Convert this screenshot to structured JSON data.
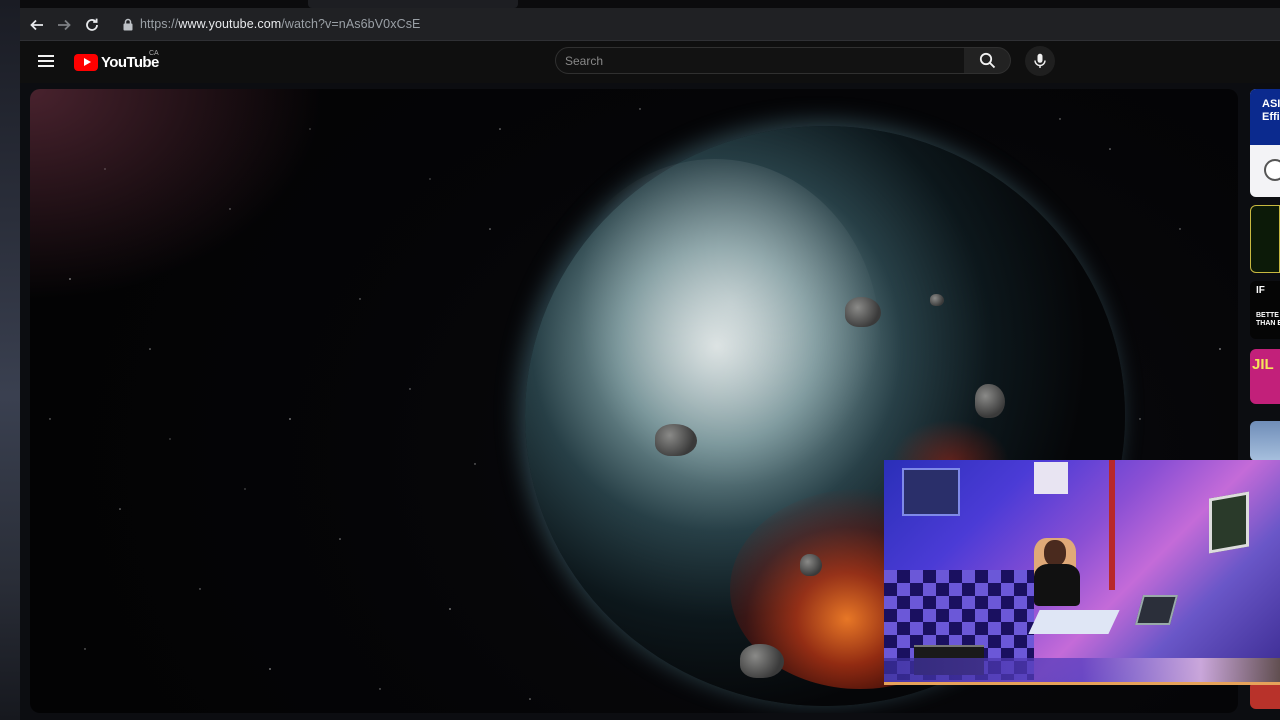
{
  "browser": {
    "url_prefix": "https://",
    "url_host": "www.youtube.com",
    "url_path": "/watch?v=nAs6bV0xCsE"
  },
  "youtube": {
    "logo_text": "YouTube",
    "region": "CA",
    "search_placeholder": "Search"
  },
  "sidebar": {
    "rec1_line1": "ASI",
    "rec1_line2": "Effi",
    "rec4_line1": "IF",
    "rec4_line2": "BETTE",
    "rec4_line3": "THAN E",
    "rec5_text": "JIL"
  },
  "colors": {
    "brand_red": "#ff0000",
    "page_bg": "#0f0f0f"
  }
}
